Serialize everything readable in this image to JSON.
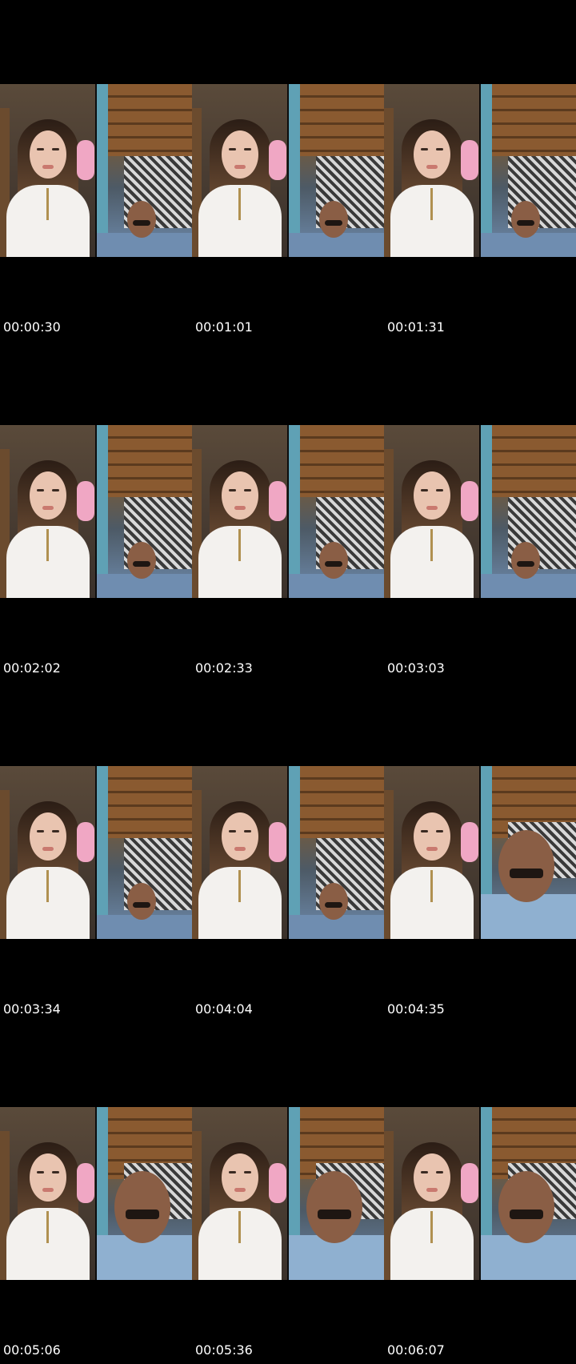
{
  "frames": [
    {
      "timestamp": "00:00:30"
    },
    {
      "timestamp": "00:01:01"
    },
    {
      "timestamp": "00:01:31"
    },
    {
      "timestamp": "00:02:02"
    },
    {
      "timestamp": "00:02:33"
    },
    {
      "timestamp": "00:03:03"
    },
    {
      "timestamp": "00:03:34"
    },
    {
      "timestamp": "00:04:04"
    },
    {
      "timestamp": "00:04:35"
    },
    {
      "timestamp": "00:05:06"
    },
    {
      "timestamp": "00:05:36"
    },
    {
      "timestamp": "00:06:07"
    }
  ]
}
